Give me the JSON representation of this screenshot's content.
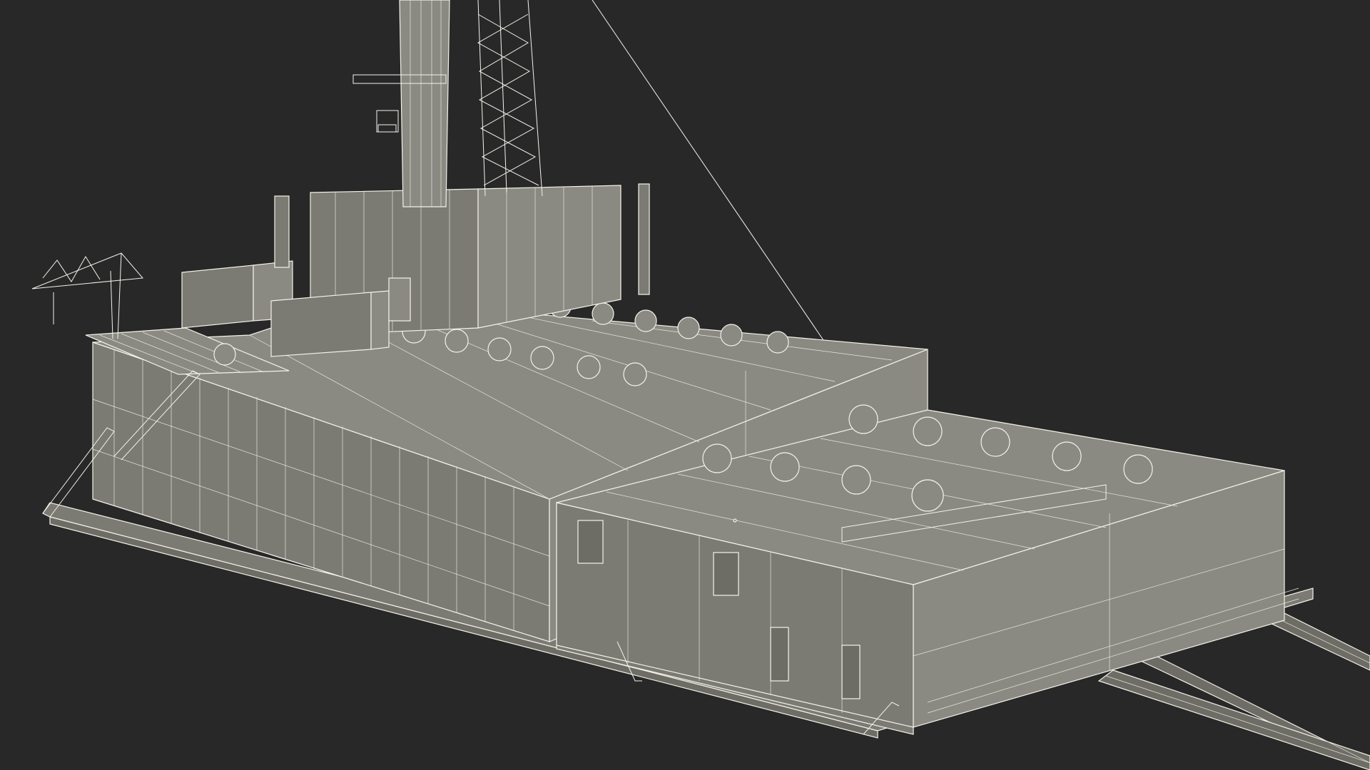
{
  "scene": {
    "subject": "drilling-rig-wireframe-render",
    "background_color": "#282828",
    "mesh_color": "#f4f2ea",
    "surface_color": "#7b7b73",
    "roof_vents": 22,
    "crane_count": 1,
    "tower_count": 1
  }
}
